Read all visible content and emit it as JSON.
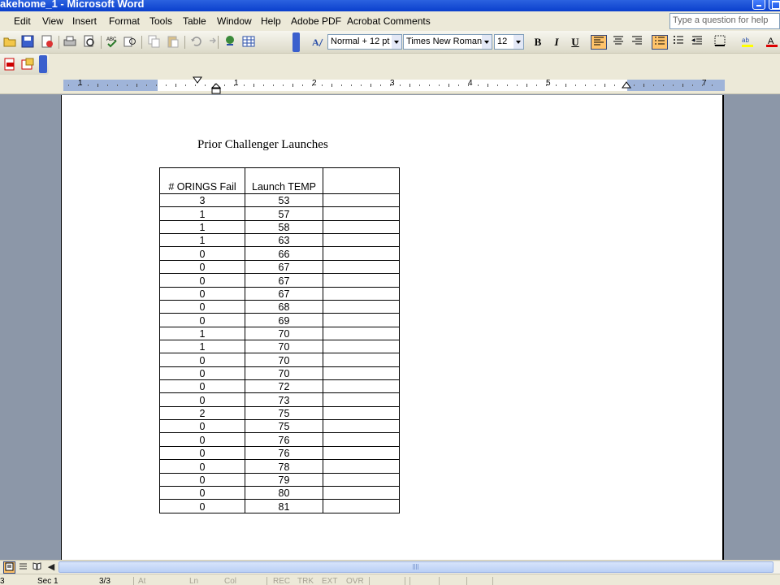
{
  "window": {
    "title": "akehome_1 - Microsoft Word"
  },
  "menu": {
    "items": [
      "Edit",
      "View",
      "Insert",
      "Format",
      "Tools",
      "Table",
      "Window",
      "Help",
      "Adobe PDF",
      "Acrobat Comments"
    ],
    "help_placeholder": "Type a question for help"
  },
  "formatting": {
    "style": "Normal + 12 pt",
    "font": "Times New Roman",
    "size": "12",
    "bold": "B",
    "italic": "I",
    "underline": "U"
  },
  "ruler": {
    "numbers": [
      "1",
      "1",
      "2",
      "3",
      "4",
      "5",
      "7"
    ]
  },
  "document": {
    "title": "Prior Challenger Launches",
    "table": {
      "headers": [
        "# ORINGS Fail",
        "Launch TEMP",
        ""
      ],
      "rows": [
        [
          "3",
          "53",
          ""
        ],
        [
          "1",
          "57",
          ""
        ],
        [
          "1",
          "58",
          ""
        ],
        [
          "1",
          "63",
          ""
        ],
        [
          "0",
          "66",
          ""
        ],
        [
          "0",
          "67",
          ""
        ],
        [
          "0",
          "67",
          ""
        ],
        [
          "0",
          "67",
          ""
        ],
        [
          "0",
          "68",
          ""
        ],
        [
          "0",
          "69",
          ""
        ],
        [
          "1",
          "70",
          ""
        ],
        [
          "1",
          "70",
          ""
        ],
        [
          "0",
          "70",
          ""
        ],
        [
          "0",
          "70",
          ""
        ],
        [
          "0",
          "72",
          ""
        ],
        [
          "0",
          "73",
          ""
        ],
        [
          "2",
          "75",
          ""
        ],
        [
          "0",
          "75",
          ""
        ],
        [
          "0",
          "76",
          ""
        ],
        [
          "0",
          "76",
          ""
        ],
        [
          "0",
          "78",
          ""
        ],
        [
          "0",
          "79",
          ""
        ],
        [
          "0",
          "80",
          ""
        ],
        [
          "0",
          "81",
          ""
        ]
      ]
    }
  },
  "statusbar": {
    "page": "3",
    "section": "Sec 1",
    "pages": "3/3",
    "at": "At",
    "ln": "Ln",
    "col": "Col",
    "rec": "REC",
    "trk": "TRK",
    "ext": "EXT",
    "ovr": "OVR"
  },
  "icons": [
    "open-icon",
    "save-icon",
    "permission-icon",
    "print-icon",
    "print-preview-icon",
    "spelling-icon",
    "research-icon",
    "copy-icon",
    "paste-icon",
    "undo-icon",
    "redo-icon",
    "hyperlink-icon",
    "insert-table-icon",
    "styles-icon",
    "align-left-icon",
    "center-icon",
    "align-right-icon",
    "numbering-icon",
    "bullets-icon",
    "decrease-indent-icon",
    "borders-icon",
    "highlight-icon",
    "font-color-icon",
    "convert-to-pdf-icon",
    "convert-and-email-icon"
  ],
  "colors": {
    "titlebar": "#0a3fcc",
    "chrome": "#ece9d8",
    "active_button": "#ffc36a",
    "workspace": "#8c97a8"
  }
}
